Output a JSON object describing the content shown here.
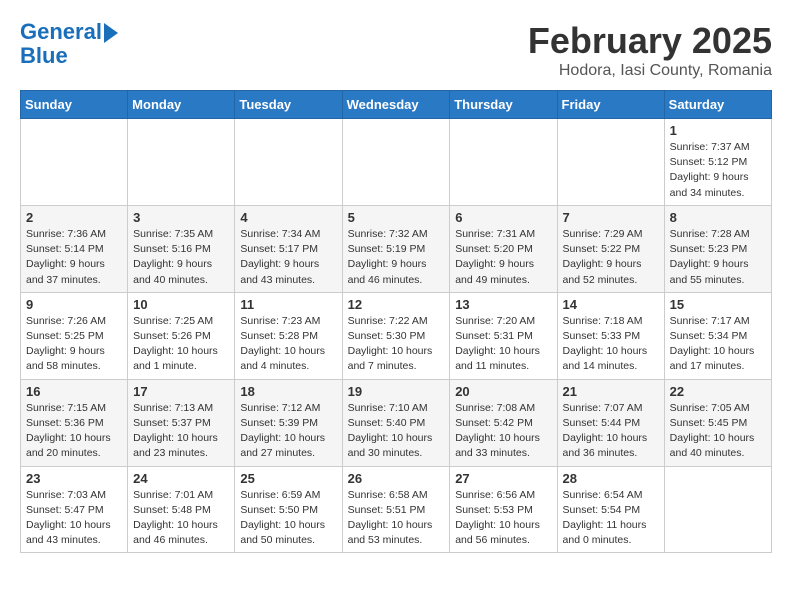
{
  "header": {
    "logo_line1": "General",
    "logo_line2": "Blue",
    "month": "February 2025",
    "location": "Hodora, Iasi County, Romania"
  },
  "weekdays": [
    "Sunday",
    "Monday",
    "Tuesday",
    "Wednesday",
    "Thursday",
    "Friday",
    "Saturday"
  ],
  "weeks": [
    [
      {
        "day": "",
        "info": ""
      },
      {
        "day": "",
        "info": ""
      },
      {
        "day": "",
        "info": ""
      },
      {
        "day": "",
        "info": ""
      },
      {
        "day": "",
        "info": ""
      },
      {
        "day": "",
        "info": ""
      },
      {
        "day": "1",
        "info": "Sunrise: 7:37 AM\nSunset: 5:12 PM\nDaylight: 9 hours and 34 minutes."
      }
    ],
    [
      {
        "day": "2",
        "info": "Sunrise: 7:36 AM\nSunset: 5:14 PM\nDaylight: 9 hours and 37 minutes."
      },
      {
        "day": "3",
        "info": "Sunrise: 7:35 AM\nSunset: 5:16 PM\nDaylight: 9 hours and 40 minutes."
      },
      {
        "day": "4",
        "info": "Sunrise: 7:34 AM\nSunset: 5:17 PM\nDaylight: 9 hours and 43 minutes."
      },
      {
        "day": "5",
        "info": "Sunrise: 7:32 AM\nSunset: 5:19 PM\nDaylight: 9 hours and 46 minutes."
      },
      {
        "day": "6",
        "info": "Sunrise: 7:31 AM\nSunset: 5:20 PM\nDaylight: 9 hours and 49 minutes."
      },
      {
        "day": "7",
        "info": "Sunrise: 7:29 AM\nSunset: 5:22 PM\nDaylight: 9 hours and 52 minutes."
      },
      {
        "day": "8",
        "info": "Sunrise: 7:28 AM\nSunset: 5:23 PM\nDaylight: 9 hours and 55 minutes."
      }
    ],
    [
      {
        "day": "9",
        "info": "Sunrise: 7:26 AM\nSunset: 5:25 PM\nDaylight: 9 hours and 58 minutes."
      },
      {
        "day": "10",
        "info": "Sunrise: 7:25 AM\nSunset: 5:26 PM\nDaylight: 10 hours and 1 minute."
      },
      {
        "day": "11",
        "info": "Sunrise: 7:23 AM\nSunset: 5:28 PM\nDaylight: 10 hours and 4 minutes."
      },
      {
        "day": "12",
        "info": "Sunrise: 7:22 AM\nSunset: 5:30 PM\nDaylight: 10 hours and 7 minutes."
      },
      {
        "day": "13",
        "info": "Sunrise: 7:20 AM\nSunset: 5:31 PM\nDaylight: 10 hours and 11 minutes."
      },
      {
        "day": "14",
        "info": "Sunrise: 7:18 AM\nSunset: 5:33 PM\nDaylight: 10 hours and 14 minutes."
      },
      {
        "day": "15",
        "info": "Sunrise: 7:17 AM\nSunset: 5:34 PM\nDaylight: 10 hours and 17 minutes."
      }
    ],
    [
      {
        "day": "16",
        "info": "Sunrise: 7:15 AM\nSunset: 5:36 PM\nDaylight: 10 hours and 20 minutes."
      },
      {
        "day": "17",
        "info": "Sunrise: 7:13 AM\nSunset: 5:37 PM\nDaylight: 10 hours and 23 minutes."
      },
      {
        "day": "18",
        "info": "Sunrise: 7:12 AM\nSunset: 5:39 PM\nDaylight: 10 hours and 27 minutes."
      },
      {
        "day": "19",
        "info": "Sunrise: 7:10 AM\nSunset: 5:40 PM\nDaylight: 10 hours and 30 minutes."
      },
      {
        "day": "20",
        "info": "Sunrise: 7:08 AM\nSunset: 5:42 PM\nDaylight: 10 hours and 33 minutes."
      },
      {
        "day": "21",
        "info": "Sunrise: 7:07 AM\nSunset: 5:44 PM\nDaylight: 10 hours and 36 minutes."
      },
      {
        "day": "22",
        "info": "Sunrise: 7:05 AM\nSunset: 5:45 PM\nDaylight: 10 hours and 40 minutes."
      }
    ],
    [
      {
        "day": "23",
        "info": "Sunrise: 7:03 AM\nSunset: 5:47 PM\nDaylight: 10 hours and 43 minutes."
      },
      {
        "day": "24",
        "info": "Sunrise: 7:01 AM\nSunset: 5:48 PM\nDaylight: 10 hours and 46 minutes."
      },
      {
        "day": "25",
        "info": "Sunrise: 6:59 AM\nSunset: 5:50 PM\nDaylight: 10 hours and 50 minutes."
      },
      {
        "day": "26",
        "info": "Sunrise: 6:58 AM\nSunset: 5:51 PM\nDaylight: 10 hours and 53 minutes."
      },
      {
        "day": "27",
        "info": "Sunrise: 6:56 AM\nSunset: 5:53 PM\nDaylight: 10 hours and 56 minutes."
      },
      {
        "day": "28",
        "info": "Sunrise: 6:54 AM\nSunset: 5:54 PM\nDaylight: 11 hours and 0 minutes."
      },
      {
        "day": "",
        "info": ""
      }
    ]
  ]
}
